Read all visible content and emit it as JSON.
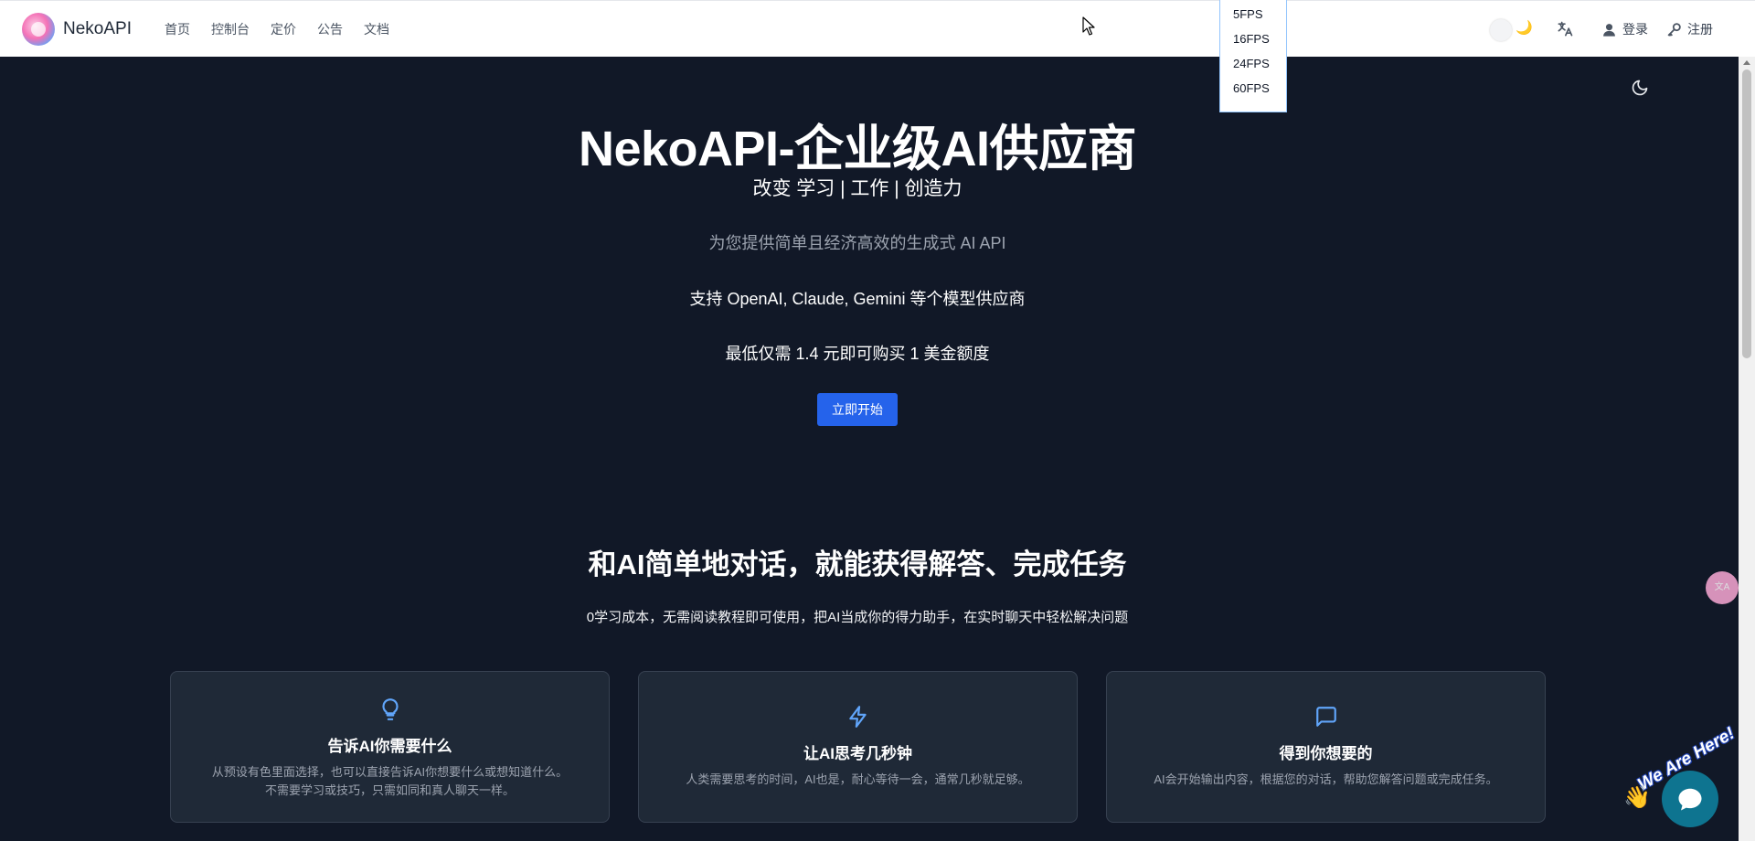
{
  "nav": {
    "brand": "NekoAPI",
    "links": [
      "首页",
      "控制台",
      "定价",
      "公告",
      "文档"
    ],
    "login": "登录",
    "register": "注册"
  },
  "fps_menu": [
    "5FPS",
    "16FPS",
    "24FPS",
    "60FPS"
  ],
  "hero": {
    "title": "NekoAPI-企业级AI供应商",
    "subtitle": "改变 学习 | 工作 | 创造力",
    "desc": "为您提供简单且经济高效的生成式 AI API",
    "line1": "支持 OpenAI, Claude, Gemini 等个模型供应商",
    "line2": "最低仅需 1.4 元即可购买 1 美金额度",
    "cta": "立即开始"
  },
  "section": {
    "title": "和AI简单地对话，就能获得解答、完成任务",
    "subtitle": "0学习成本，无需阅读教程即可使用，把AI当成你的得力助手，在实时聊天中轻松解决问题"
  },
  "cards": [
    {
      "icon": "lightbulb-icon",
      "title": "告诉AI你需要什么",
      "desc": "从预设有色里面选择，也可以直接告诉AI你想要什么或想知道什么。",
      "desc2": "不需要学习或技巧，只需如同和真人聊天一样。"
    },
    {
      "icon": "lightning-icon",
      "title": "让AI思考几秒钟",
      "desc": "人类需要思考的时间，AI也是，耐心等待一会，通常几秒就足够。"
    },
    {
      "icon": "chat-bubble-icon",
      "title": "得到你想要的",
      "desc": "AI会开始输出内容，根据您的对话，帮助您解答问题或完成任务。"
    }
  ],
  "widget": {
    "label": "We Are Here!"
  },
  "colors": {
    "background": "#111827",
    "accent": "#2563eb",
    "card": "#1f2937",
    "icon": "#60a5fa",
    "chat": "#0e7490"
  }
}
